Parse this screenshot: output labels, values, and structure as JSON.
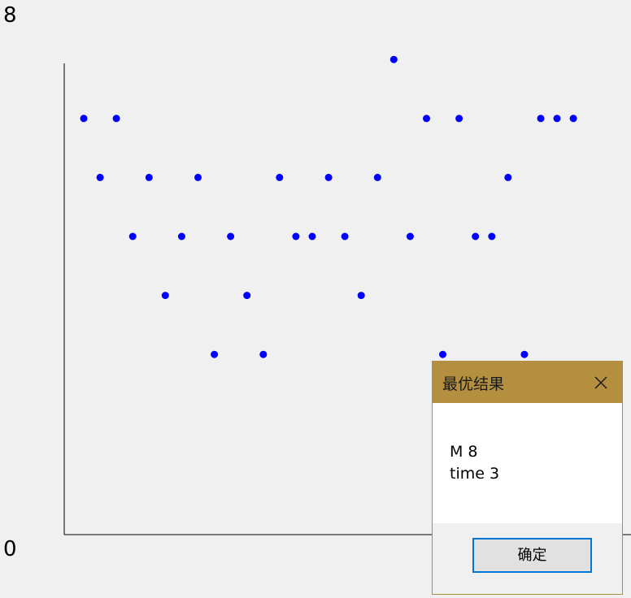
{
  "chart_data": {
    "type": "scatter",
    "title": "",
    "xlabel": "",
    "ylabel": "",
    "ylim": [
      0,
      8
    ],
    "y_max_label": "8",
    "y_min_label": "0",
    "point_color": "#0000ff",
    "x": [
      1,
      2,
      3,
      4,
      5,
      6,
      7,
      8,
      9,
      10,
      11,
      12,
      13,
      14,
      15,
      16,
      17,
      18,
      19,
      20,
      21,
      22,
      23,
      24,
      25,
      26,
      27,
      28,
      29,
      30,
      31
    ],
    "values": [
      7,
      6,
      7,
      5,
      6,
      4,
      5,
      6,
      3,
      5,
      4,
      3,
      6,
      5,
      5,
      6,
      5,
      4,
      6,
      8,
      5,
      7,
      3,
      7,
      5,
      5,
      6,
      3,
      7,
      7,
      7
    ]
  },
  "dialog": {
    "title": "最优结果",
    "line1": "M 8",
    "line2": "time 3",
    "ok_label": "确定",
    "title_bar_color": "#b38f3f"
  }
}
